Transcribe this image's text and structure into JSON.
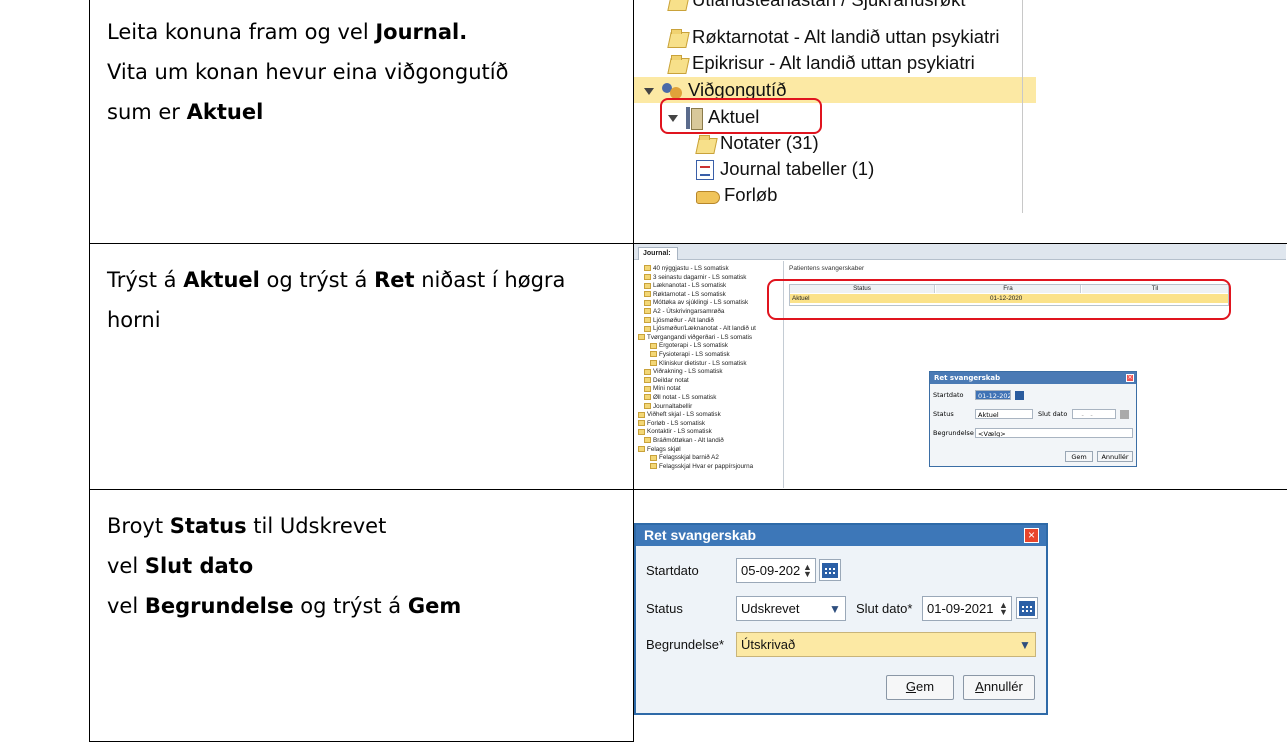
{
  "rows": [
    {
      "lines": [
        {
          "parts": [
            {
              "text": "Leita konuna fram og vel ",
              "bold": false
            },
            {
              "text": "Journal.",
              "bold": true
            }
          ]
        },
        {
          "parts": [
            {
              "text": "Vita um konan hevur eina viðgongutíð",
              "bold": false
            }
          ]
        },
        {
          "parts": [
            {
              "text": "sum er ",
              "bold": false
            },
            {
              "text": "Aktuel",
              "bold": true
            }
          ]
        }
      ]
    },
    {
      "lines": [
        {
          "parts": [
            {
              "text": "Trýst á ",
              "bold": false
            },
            {
              "text": "Aktuel",
              "bold": true
            },
            {
              "text": " og trýst á  ",
              "bold": false
            },
            {
              "text": "Ret",
              "bold": true
            },
            {
              "text": " niðast í høgra",
              "bold": false
            }
          ]
        },
        {
          "parts": [
            {
              "text": "horni",
              "bold": false
            }
          ]
        }
      ]
    },
    {
      "lines": [
        {
          "parts": [
            {
              "text": "Broyt ",
              "bold": false
            },
            {
              "text": "Status",
              "bold": true
            },
            {
              "text": " til Udskrevet",
              "bold": false
            }
          ]
        },
        {
          "parts": [
            {
              "text": "vel ",
              "bold": false
            },
            {
              "text": "Slut dato",
              "bold": true
            }
          ]
        },
        {
          "parts": [
            {
              "text": "vel ",
              "bold": false
            },
            {
              "text": "Begrundelse",
              "bold": true
            },
            {
              "text": " og trýst á ",
              "bold": false
            },
            {
              "text": "Gem",
              "bold": true
            }
          ]
        }
      ]
    }
  ],
  "tree1": {
    "items": [
      {
        "label": "Útlandsteanastan / Sjúkrahúsrøkt",
        "icon": "folder-icon",
        "indent": 1
      },
      {
        "label": "Røktarnotat - Alt landið uttan psykiatri",
        "icon": "folder-icon",
        "indent": 1
      },
      {
        "label": "Epikrisur - Alt landið uttan psykiatri",
        "icon": "folder-icon",
        "indent": 1
      },
      {
        "label": "Viðgongutíð",
        "icon": "people-icon",
        "indent": 0,
        "highlight": true
      },
      {
        "label": "Aktuel",
        "icon": "binder-icon",
        "indent": 1
      },
      {
        "label": "Notater (31)",
        "icon": "folder-icon",
        "indent": 2
      },
      {
        "label": "Journal tabeller (1)",
        "icon": "document-icon",
        "indent": 2
      },
      {
        "label": "Forløb",
        "icon": "hand-icon",
        "indent": 2
      }
    ]
  },
  "shot2": {
    "tab": "Journal:",
    "tree_items": [
      "40 nýggjastu - LS somatisk",
      "3 seinastu dagarnir - LS somatisk",
      "Læknanotat - LS somatisk",
      "Røktarnotat - LS somatisk",
      "Móttøka av sjúklingi - LS somatisk",
      "A2 - Útskrivingarsamrøða",
      "Ljósmøður - Alt landið",
      "Ljósmøður/Læknanotat - Alt landið ut",
      "Tvørgangandi viðgerðari - LS somatis",
      "Ergoterapi - LS somatisk",
      "Fysioterapi - LS somatisk",
      "Kliniskur dietistur - LS somatisk",
      "Viðrakning - LS somatisk",
      "Deildar notat",
      "Míni notat",
      "Øll notat - LS somatisk",
      "Journaltabellir",
      "Viðheft skjal - LS somatisk",
      "Forløb - LS somatisk",
      "Kontaktir - LS somatisk",
      "Bráðmóttøkan - Alt landið",
      "Felags skjøl",
      "Felagsskjal barnið A2",
      "Felagsskjal Hvar er pappírsjourna"
    ],
    "panel_title": "Patientens svangerskaber",
    "columns": [
      "Status",
      "Fra",
      "Til"
    ],
    "row": {
      "status": "Aktuel",
      "fra": "01-12-2020",
      "til": ""
    },
    "dialog": {
      "title": "Ret svangerskab",
      "startdato_label": "Startdato",
      "startdato": "01-12-2020",
      "status_label": "Status",
      "status": "Aktuel",
      "slut_label": "Slut dato",
      "slut": "__-__-____",
      "begrundelse_label": "Begrundelse",
      "begrundelse": "<Vælg>",
      "gem": "Gem",
      "annuller": "Annullér"
    }
  },
  "dialog3": {
    "title": "Ret svangerskab",
    "startdato_label": "Startdato",
    "startdato": "05-09-202",
    "status_label": "Status",
    "status": "Udskrevet",
    "slut_label": "Slut dato*",
    "slut": "01-09-2021",
    "begrundelse_label": "Begrundelse*",
    "begrundelse": "Útskrivað",
    "gem_first": "G",
    "gem_rest": "em",
    "annuller_first": "A",
    "annuller_rest": "nnullér"
  },
  "colors": {
    "highlight": "#fce9a4",
    "annotation_red": "#e0141e",
    "dialog_title": "#3d77b8"
  }
}
